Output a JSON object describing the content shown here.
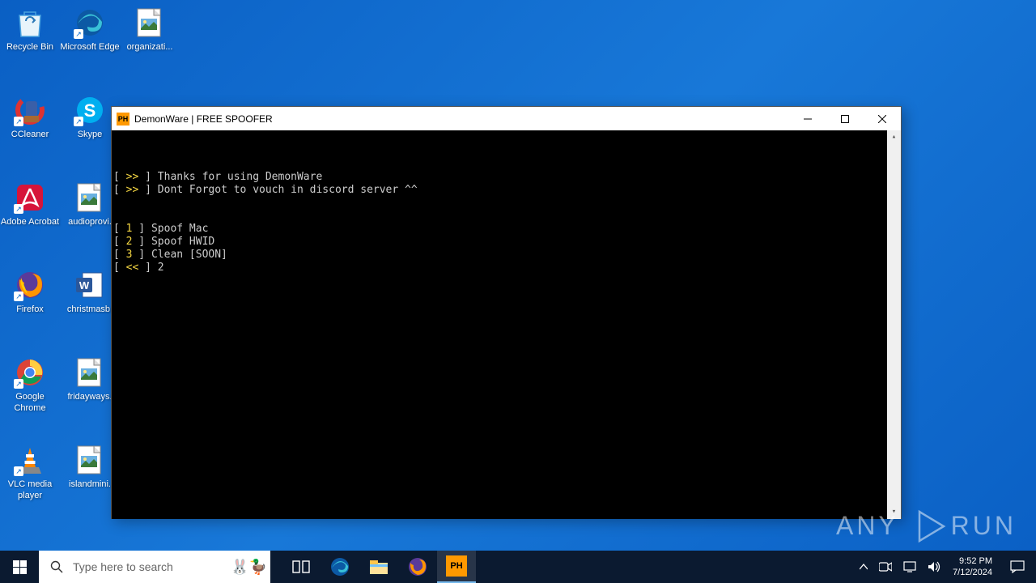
{
  "desktop_icons": [
    {
      "label": "Recycle Bin",
      "col": 0,
      "row": 0,
      "type": "recycle"
    },
    {
      "label": "Microsoft Edge",
      "col": 1,
      "row": 0,
      "type": "edge",
      "shortcut": true
    },
    {
      "label": "organizati...",
      "col": 2,
      "row": 0,
      "type": "image"
    },
    {
      "label": "CCleaner",
      "col": 0,
      "row": 1,
      "type": "ccleaner",
      "shortcut": true
    },
    {
      "label": "Skype",
      "col": 1,
      "row": 1,
      "type": "skype",
      "shortcut": true
    },
    {
      "label": "Adobe Acrobat",
      "col": 0,
      "row": 2,
      "type": "acrobat",
      "shortcut": true
    },
    {
      "label": "audioprovi.",
      "col": 1,
      "row": 2,
      "type": "image"
    },
    {
      "label": "Firefox",
      "col": 0,
      "row": 3,
      "type": "firefox",
      "shortcut": true
    },
    {
      "label": "christmasb.",
      "col": 1,
      "row": 3,
      "type": "word"
    },
    {
      "label": "Google Chrome",
      "col": 0,
      "row": 4,
      "type": "chrome",
      "shortcut": true
    },
    {
      "label": "fridayways.",
      "col": 1,
      "row": 4,
      "type": "image"
    },
    {
      "label": "VLC media player",
      "col": 0,
      "row": 5,
      "type": "vlc",
      "shortcut": true
    },
    {
      "label": "islandmini.",
      "col": 1,
      "row": 5,
      "type": "image"
    }
  ],
  "window": {
    "app_icon_text": "PH",
    "title": "DemonWare | FREE SPOOFER",
    "terminal": {
      "banner": [
        {
          "sym": ">>",
          "text": "Thanks for using DemonWare"
        },
        {
          "sym": ">>",
          "text": "Dont Forgot to vouch in discord server ^^"
        }
      ],
      "menu": [
        {
          "sym": "1",
          "text": "Spoof Mac"
        },
        {
          "sym": "2",
          "text": "Spoof HWID"
        },
        {
          "sym": "3",
          "text": "Clean [SOON]"
        }
      ],
      "prompt": {
        "sym": "<<",
        "input": "2"
      }
    }
  },
  "taskbar": {
    "search_placeholder": "Type here to search",
    "apps": [
      {
        "name": "task-view",
        "type": "taskview"
      },
      {
        "name": "edge",
        "type": "edge"
      },
      {
        "name": "file-explorer",
        "type": "explorer"
      },
      {
        "name": "firefox",
        "type": "firefox"
      },
      {
        "name": "demonware",
        "type": "ph",
        "active": true
      }
    ],
    "tray": {
      "time": "9:52 PM",
      "date": "7/12/2024"
    }
  },
  "watermark": "ANY     RUN"
}
